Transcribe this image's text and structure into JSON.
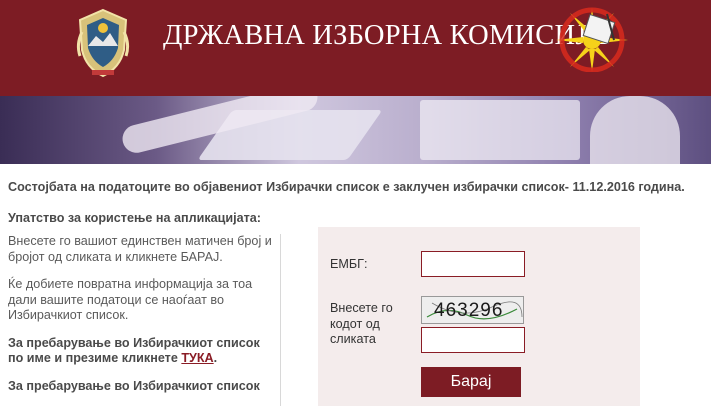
{
  "header": {
    "title": "ДРЖАВНА ИЗБОРНА КОМИСИЈА"
  },
  "status": {
    "text": "Состојбата на податоците во објавениот Избирачки список е заклучен избирачки список- 11.12.2016 година."
  },
  "instructions": {
    "title": "Упатство за користење на апликацијата:",
    "p1": "Внесете го вашиот единствен матичен број и бројот од сликата и кликнете БАРАЈ.",
    "p2": "Ќе добиете повратна информација за тоа дали вашите податоци се наоѓаат во Избирачкиот список.",
    "p3_text": "За пребарување во Избирачкиот список по име и презиме кликнете ",
    "p3_link": "ТУКА",
    "p3_end": ".",
    "p4": "За пребарување во Избирачкиот  список"
  },
  "form": {
    "embg_label": "ЕМБГ:",
    "embg_value": "",
    "captcha_label": "Внесете го кодот од сликата",
    "captcha_text": "463296",
    "captcha_value": "",
    "search_button": "Барај"
  },
  "colors": {
    "brand": "#7d1c24",
    "form_background": "#f4ecec"
  },
  "icons": {
    "coat": "coat-of-arms-icon",
    "emblem": "election-commission-emblem-icon"
  }
}
